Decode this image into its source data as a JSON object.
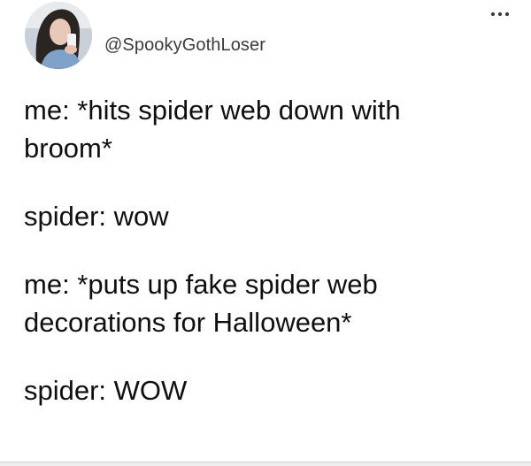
{
  "tweet": {
    "handle": "@SpookyGothLoser",
    "lines": [
      "me: *hits spider web down with",
      "broom*",
      "spider: wow",
      "me: *puts up fake spider web",
      "decorations for Halloween*",
      "spider: WOW"
    ]
  },
  "icons": {
    "more": "more-horizontal-icon"
  }
}
